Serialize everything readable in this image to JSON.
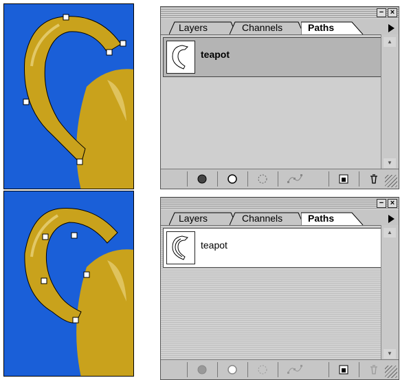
{
  "colors": {
    "background_blue": "#1a5fd8",
    "teapot_gold": "#c9a21c",
    "panel_gray": "#c6c6c6"
  },
  "panels": [
    {
      "tabs": [
        {
          "label": "Layers",
          "active": false
        },
        {
          "label": "Channels",
          "active": false
        },
        {
          "label": "Paths",
          "active": true
        }
      ],
      "path_item": {
        "name": "teapot",
        "selected": true
      },
      "toolbar_icons": [
        "fill-path-icon",
        "stroke-path-icon",
        "load-selection-icon",
        "make-work-path-icon",
        "new-path-icon",
        "trash-icon"
      ]
    },
    {
      "tabs": [
        {
          "label": "Layers",
          "active": false
        },
        {
          "label": "Channels",
          "active": false
        },
        {
          "label": "Paths",
          "active": true
        }
      ],
      "path_item": {
        "name": "teapot",
        "selected": false
      },
      "toolbar_icons": [
        "fill-path-icon",
        "stroke-path-icon",
        "load-selection-icon",
        "make-work-path-icon",
        "new-path-icon",
        "trash-icon"
      ]
    }
  ]
}
